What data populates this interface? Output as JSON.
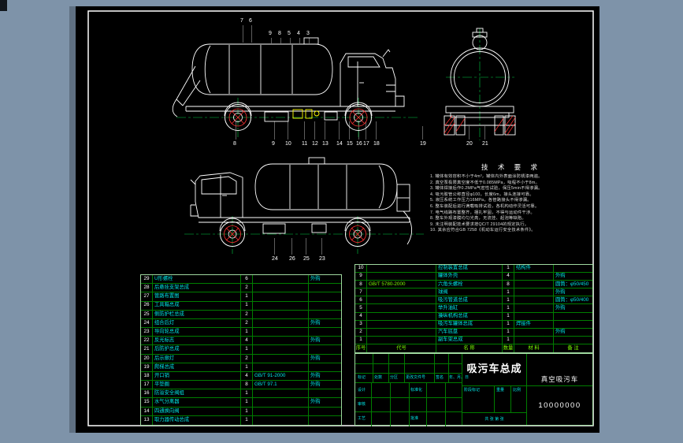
{
  "app": {
    "background": "#7e93a9",
    "canvas_background": "#000000",
    "colors": {
      "line": "#ffffff",
      "centerline": "#00cc44",
      "wheel_hatch": "#ff3333",
      "highlight": "#ffff00",
      "table_grid": "#007d00",
      "table_text": "#00e5e5"
    }
  },
  "callouts": {
    "top_upper": [
      "7",
      "6"
    ],
    "top_mid": [
      "9",
      "8",
      "5",
      "4",
      "3"
    ],
    "top_bottom": [
      "8",
      "9",
      "10",
      "11",
      "12",
      "13",
      "14",
      "15",
      "16",
      "17",
      "18"
    ],
    "rear_bottom": [
      "19",
      "20",
      "21"
    ],
    "mid_bottom": [
      "24",
      "26",
      "25",
      "23"
    ]
  },
  "tech_notes": {
    "title": "技 术 要 求",
    "lines": [
      "1. 罐体有效容积不小于4m³，罐体内外表面涂防锈漆两遍。",
      "2. 真空泵极限真空度不低于0.085MPa，吸程不小于8m。",
      "3. 罐体焊接后作0.2MPa气密性试验，保压5min不得渗漏。",
      "4. 吸污胶管公称直径φ100，长度6m，接头连接可靠。",
      "5. 液压系统工作压力16MPa，各管路接头不得渗漏。",
      "6. 整车装配后进行满载吸排试验，各机构动作灵活可靠。",
      "7. 电气线路布置整齐，捆扎牢固，不得与运动件干涉。",
      "8. 整车外观漆膜均匀光亮，无流挂、起泡等缺陷。",
      "9. 未注明装配技术要求按QC/T 29104的规定执行。",
      "10. 其余应符合GB 7258《机动车运行安全技术条件》。"
    ]
  },
  "bom_left": {
    "rows": [
      {
        "no": "29",
        "name": "U形螺栓",
        "qty": "6",
        "material": "",
        "remark": "外购"
      },
      {
        "no": "28",
        "name": "后悬挂支架总成",
        "qty": "2",
        "material": "",
        "remark": ""
      },
      {
        "no": "27",
        "name": "管路布置图",
        "qty": "1",
        "material": "",
        "remark": ""
      },
      {
        "no": "26",
        "name": "工具箱总成",
        "qty": "1",
        "material": "",
        "remark": ""
      },
      {
        "no": "25",
        "name": "侧防护栏总成",
        "qty": "2",
        "material": "",
        "remark": ""
      },
      {
        "no": "24",
        "name": "组合后灯",
        "qty": "2",
        "material": "",
        "remark": "外购"
      },
      {
        "no": "23",
        "name": "导向轮总成",
        "qty": "1",
        "material": "",
        "remark": ""
      },
      {
        "no": "22",
        "name": "反光标志",
        "qty": "4",
        "material": "",
        "remark": "外购"
      },
      {
        "no": "21",
        "name": "后防护总成",
        "qty": "1",
        "material": "",
        "remark": ""
      },
      {
        "no": "20",
        "name": "后示廓灯",
        "qty": "2",
        "material": "",
        "remark": "外购"
      },
      {
        "no": "19",
        "name": "爬梯总成",
        "qty": "1",
        "material": "",
        "remark": ""
      },
      {
        "no": "18",
        "name": "开口销",
        "qty": "4",
        "material": "GB/T 91-2000",
        "remark": "外购"
      },
      {
        "no": "17",
        "name": "平垫圈",
        "qty": "8",
        "material": "GB/T 97.1",
        "remark": "外购"
      },
      {
        "no": "16",
        "name": "防溢安全阀组",
        "qty": "1",
        "material": "",
        "remark": ""
      },
      {
        "no": "15",
        "name": "水气分离器",
        "qty": "1",
        "material": "",
        "remark": "外购"
      },
      {
        "no": "14",
        "name": "四通换向阀",
        "qty": "1",
        "material": "",
        "remark": ""
      },
      {
        "no": "13",
        "name": "取力器传动总成",
        "qty": "1",
        "material": "",
        "remark": ""
      }
    ]
  },
  "bom_right": {
    "header": [
      "序号",
      "代号",
      "名 称",
      "数量",
      "材 料",
      "备 注"
    ],
    "rows": [
      {
        "no": "10",
        "code": "",
        "name": "控制装置总成",
        "qty": "1",
        "material": "结构件",
        "remark": ""
      },
      {
        "no": "9",
        "code": "",
        "name": "罐体外壳",
        "qty": "4",
        "material": "",
        "remark": "外购"
      },
      {
        "no": "8",
        "code": "GB/T 5780-2000",
        "name": "六角头螺栓",
        "qty": "8",
        "material": "",
        "remark": "圆筒：φ50/450"
      },
      {
        "no": "7",
        "code": "",
        "name": "球阀",
        "qty": "1",
        "material": "",
        "remark": "外购"
      },
      {
        "no": "6",
        "code": "",
        "name": "吸污管道总成",
        "qty": "1",
        "material": "",
        "remark": "圆筒：φ50/400"
      },
      {
        "no": "5",
        "code": "",
        "name": "举升油缸",
        "qty": "1",
        "material": "",
        "remark": "外购"
      },
      {
        "no": "4",
        "code": "",
        "name": "操纵机构总成",
        "qty": "1",
        "material": "",
        "remark": ""
      },
      {
        "no": "3",
        "code": "",
        "name": "吸污车罐体总成",
        "qty": "1",
        "material": "焊接件",
        "remark": ""
      },
      {
        "no": "2",
        "code": "",
        "name": "汽车底盘",
        "qty": "1",
        "material": "",
        "remark": "外购"
      },
      {
        "no": "1",
        "code": "",
        "name": "副车架总成",
        "qty": "1",
        "material": "",
        "remark": ""
      }
    ]
  },
  "title_block": {
    "main_title": "吸污车总成",
    "product_name": "真空吸污车",
    "drawing_no": "10000000",
    "change_header": [
      "标记",
      "处数",
      "分区",
      "更改文件号",
      "签名",
      "年、月、日"
    ],
    "sign_rows_left": [
      "设计",
      "审核",
      "工艺"
    ],
    "sign_rows_right": [
      "标准化",
      "",
      "批准"
    ],
    "stage_labels": [
      "阶段标记",
      "重量",
      "比例"
    ],
    "sheet_info": "共 张   第 张"
  }
}
